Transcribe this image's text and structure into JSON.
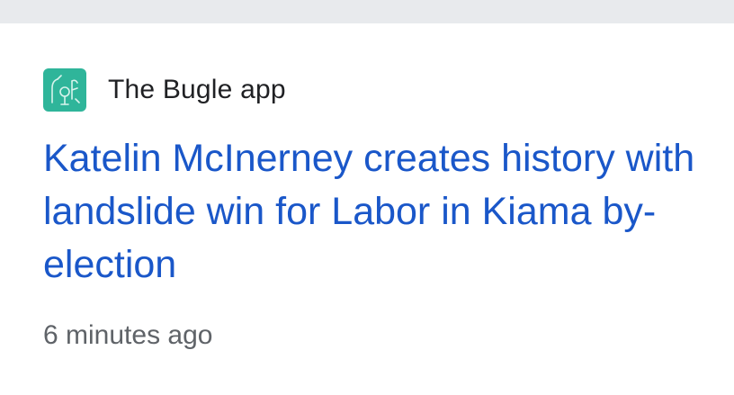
{
  "source": {
    "icon": "the-bugle-app-logo",
    "name": "The Bugle app"
  },
  "article": {
    "headline": "Katelin McInerney creates history with landslide win for Labor in Kiama by-election",
    "timestamp": "6 minutes ago"
  },
  "colors": {
    "headline": "#1a57c9",
    "icon_bg": "#2fb59a",
    "top_strip": "#e8eaed",
    "timestamp": "#5f6368"
  }
}
